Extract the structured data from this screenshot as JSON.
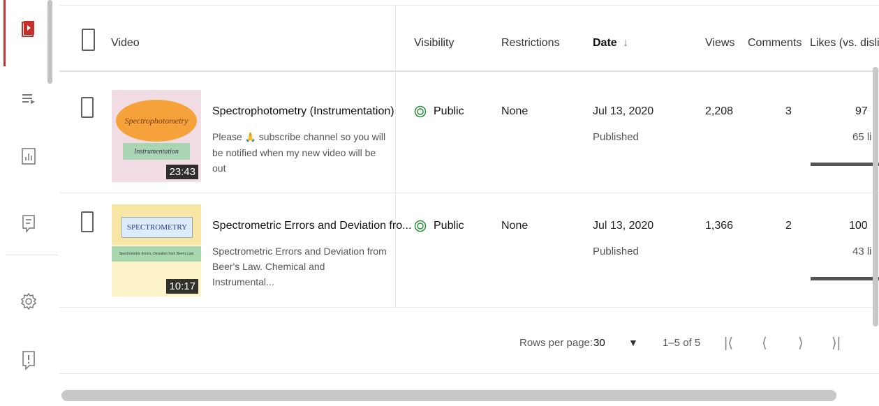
{
  "rail": {
    "icons": [
      "videos-icon",
      "playlists-icon",
      "analytics-icon",
      "comments-icon",
      "settings-icon",
      "feedback-icon"
    ]
  },
  "header": {
    "video": "Video",
    "visibility": "Visibility",
    "restrictions": "Restrictions",
    "date": "Date",
    "date_sort": "↓",
    "views": "Views",
    "comments": "Comments",
    "likes": "Likes (vs. disli"
  },
  "rows": [
    {
      "thumb_top_text": "Spectrophotometry",
      "thumb_bottom_text": "Instrumentation",
      "duration": "23:43",
      "title": "Spectrophotometry (Instrumentation)",
      "desc_a": "Please ",
      "desc_emoji": "🙏",
      "desc_b": " subscribe channel so you will be notified when my new video will be out",
      "visibility": "Public",
      "restrictions": "None",
      "date": "Jul 13, 2020",
      "date_status": "Published",
      "views": "2,208",
      "comments": "3",
      "likes": "97",
      "likes_sub": "65 li"
    },
    {
      "thumb_top_text": "SPECTROMETRY",
      "thumb_mid_text": "Spectrometric Errors, Deviation from Beer's Law",
      "duration": "10:17",
      "title": "Spectrometric Errors and Deviation fro...",
      "desc": "Spectrometric Errors and Deviation from Beer's Law. Chemical and Instrumental...",
      "visibility": "Public",
      "restrictions": "None",
      "date": "Jul 13, 2020",
      "date_status": "Published",
      "views": "1,366",
      "comments": "2",
      "likes": "100",
      "likes_sub": "43 li"
    }
  ],
  "pagination": {
    "rows_label": "Rows per page:",
    "rows_value": "30",
    "range": "1–5 of 5"
  },
  "colors": {
    "accent": "#c4302b",
    "text": "#0d0d0d",
    "muted": "#555555"
  }
}
